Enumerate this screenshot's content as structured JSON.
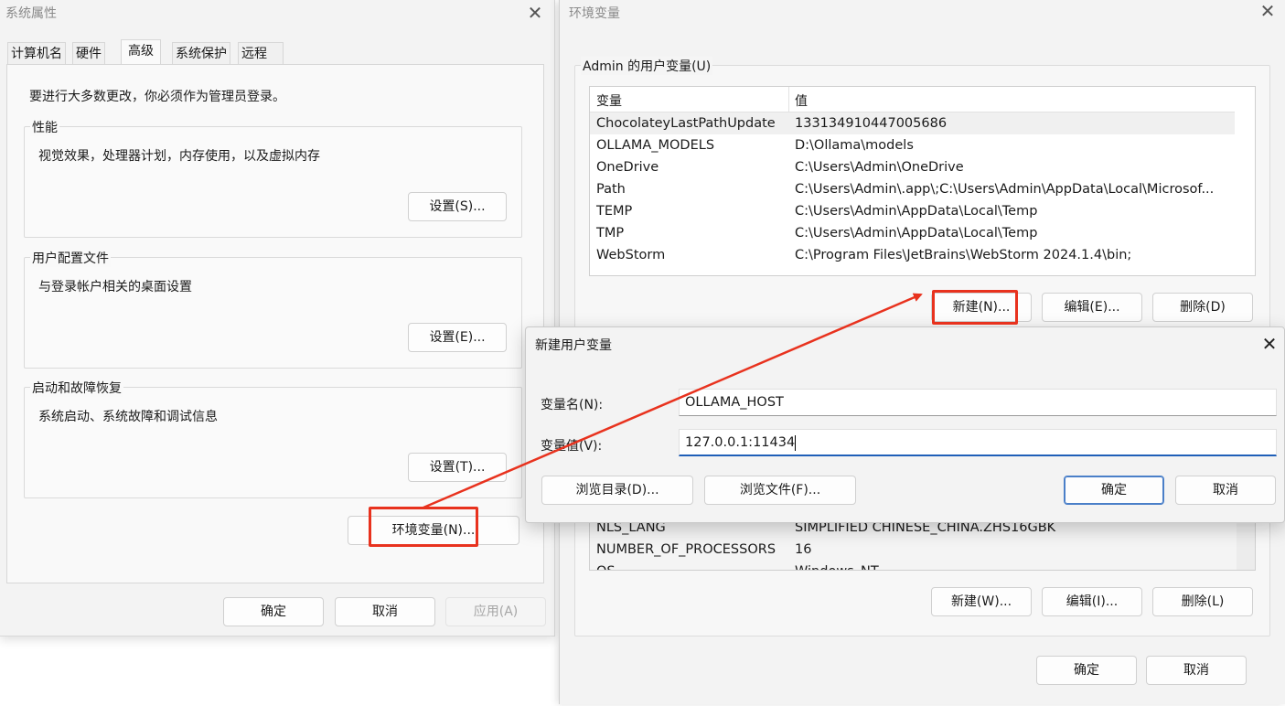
{
  "sysprops": {
    "title": "系统属性",
    "tabs": [
      "计算机名",
      "硬件",
      "高级",
      "系统保护",
      "远程"
    ],
    "note": "要进行大多数更改，你必须作为管理员登录。",
    "performance": {
      "label": "性能",
      "desc": "视觉效果，处理器计划，内存使用，以及虚拟内存",
      "button": "设置(S)..."
    },
    "profiles": {
      "label": "用户配置文件",
      "desc": "与登录帐户相关的桌面设置",
      "button": "设置(E)..."
    },
    "startup": {
      "label": "启动和故障恢复",
      "desc": "系统启动、系统故障和调试信息",
      "button": "设置(T)..."
    },
    "env_button": "环境变量(N)...",
    "ok": "确定",
    "cancel": "取消",
    "apply": "应用(A)"
  },
  "envvars": {
    "title": "环境变量",
    "user_group_label": "Admin 的用户变量(U)",
    "columns": {
      "name": "变量",
      "value": "值"
    },
    "user_vars": [
      {
        "name": "ChocolateyLastPathUpdate",
        "value": "133134910447005686"
      },
      {
        "name": "OLLAMA_MODELS",
        "value": "D:\\Ollama\\models"
      },
      {
        "name": "OneDrive",
        "value": "C:\\Users\\Admin\\OneDrive"
      },
      {
        "name": "Path",
        "value": "C:\\Users\\Admin\\.app\\;C:\\Users\\Admin\\AppData\\Local\\Microsof..."
      },
      {
        "name": "TEMP",
        "value": "C:\\Users\\Admin\\AppData\\Local\\Temp"
      },
      {
        "name": "TMP",
        "value": "C:\\Users\\Admin\\AppData\\Local\\Temp"
      },
      {
        "name": "WebStorm",
        "value": "C:\\Program Files\\JetBrains\\WebStorm 2024.1.4\\bin;"
      }
    ],
    "user_buttons": {
      "new": "新建(N)...",
      "edit": "编辑(E)...",
      "delete": "删除(D)"
    },
    "system_vars": [
      {
        "name": "NLS_LANG",
        "value": "SIMPLIFIED CHINESE_CHINA.ZHS16GBK"
      },
      {
        "name": "NUMBER_OF_PROCESSORS",
        "value": "16"
      },
      {
        "name": "OS",
        "value": "Windows_NT"
      }
    ],
    "system_buttons": {
      "new": "新建(W)...",
      "edit": "编辑(I)...",
      "delete": "删除(L)"
    },
    "ok": "确定",
    "cancel": "取消"
  },
  "newvar": {
    "title": "新建用户变量",
    "name_label": "变量名(N):",
    "value_label": "变量值(V):",
    "name_value": "OLLAMA_HOST",
    "value_value": "127.0.0.1:11434",
    "browse_dir": "浏览目录(D)...",
    "browse_file": "浏览文件(F)...",
    "ok": "确定",
    "cancel": "取消"
  },
  "colors": {
    "highlight": "#e8321e",
    "primary_border": "#4a7fc8"
  },
  "icons": {
    "close": "close-icon"
  }
}
